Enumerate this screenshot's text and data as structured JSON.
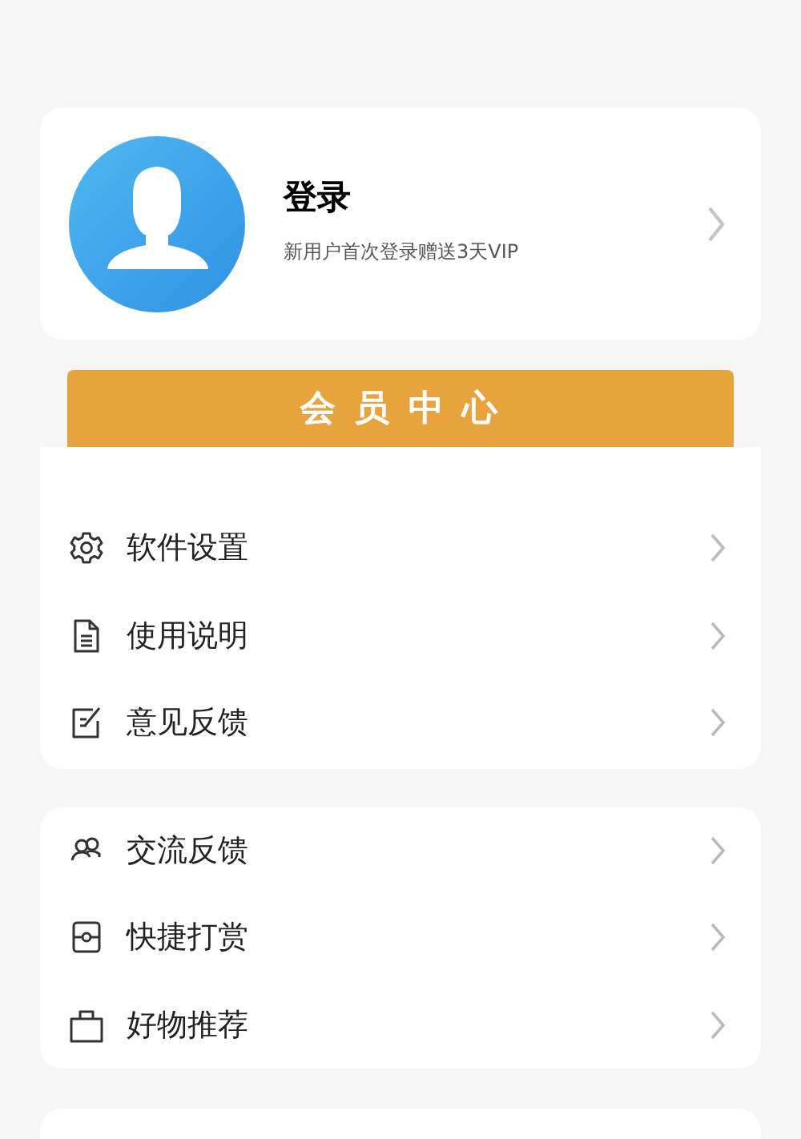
{
  "profile": {
    "title": "登录",
    "subtitle": "新用户首次登录赠送3天VIP"
  },
  "member_button": "会 员 中 心",
  "groups": [
    {
      "items": [
        {
          "label": "软件设置"
        },
        {
          "label": "使用说明"
        },
        {
          "label": "意见反馈"
        }
      ]
    },
    {
      "items": [
        {
          "label": "交流反馈"
        },
        {
          "label": "快捷打赏"
        },
        {
          "label": "好物推荐"
        }
      ]
    }
  ]
}
